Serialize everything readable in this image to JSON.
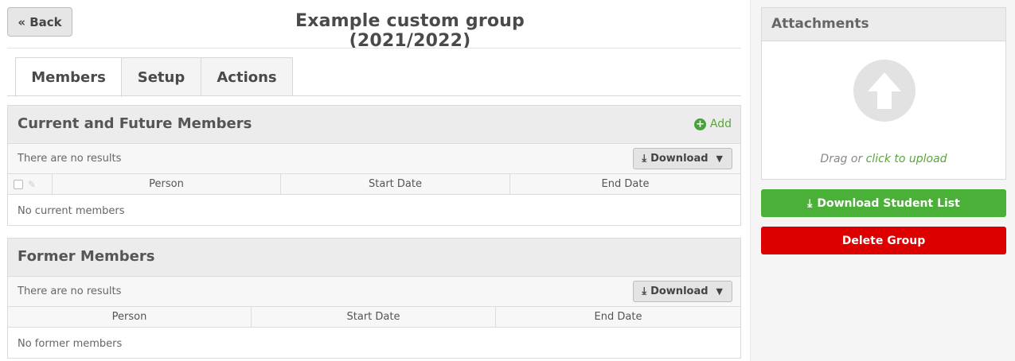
{
  "header": {
    "back_label": "« Back",
    "title": "Example custom group (2021/2022)"
  },
  "tabs": [
    {
      "label": "Members",
      "active": true
    },
    {
      "label": "Setup",
      "active": false
    },
    {
      "label": "Actions",
      "active": false
    }
  ],
  "current_members": {
    "title": "Current and Future Members",
    "add_label": "Add",
    "no_results": "There are no results",
    "download_label": "Download",
    "columns": [
      "Person",
      "Start Date",
      "End Date"
    ],
    "empty_message": "No current members"
  },
  "former_members": {
    "title": "Former Members",
    "no_results": "There are no results",
    "download_label": "Download",
    "columns": [
      "Person",
      "Start Date",
      "End Date"
    ],
    "empty_message": "No former members"
  },
  "attachments": {
    "title": "Attachments",
    "drag_text": "Drag or ",
    "upload_link": "click to upload"
  },
  "actions": {
    "download_student_list": "Download Student List",
    "delete_group": "Delete Group"
  },
  "colors": {
    "green": "#4bb038",
    "red": "#dd0000",
    "link_green": "#5aa53a"
  },
  "icons": [
    "download-icon",
    "plus-circle-icon",
    "upload-arrow-icon",
    "caret-down-icon",
    "checkbox-icon",
    "pencil-icon"
  ]
}
